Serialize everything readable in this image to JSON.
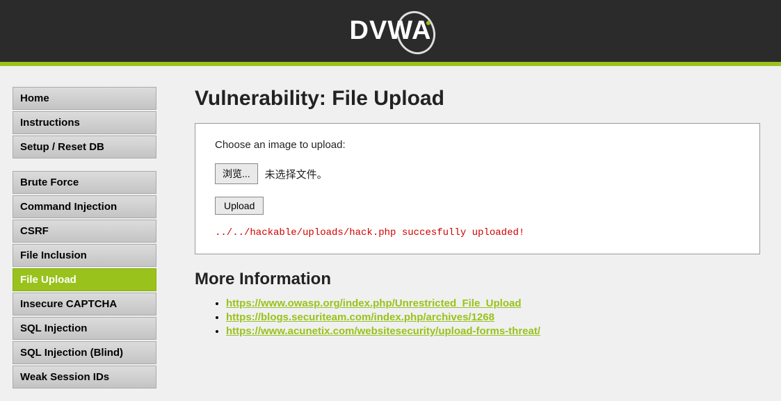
{
  "header": {
    "logo_text": "DVWA"
  },
  "sidebar": {
    "group1": [
      {
        "label": "Home",
        "name": "sidebar-item-home",
        "active": false
      },
      {
        "label": "Instructions",
        "name": "sidebar-item-instructions",
        "active": false
      },
      {
        "label": "Setup / Reset DB",
        "name": "sidebar-item-setup",
        "active": false
      }
    ],
    "group2": [
      {
        "label": "Brute Force",
        "name": "sidebar-item-brute-force",
        "active": false
      },
      {
        "label": "Command Injection",
        "name": "sidebar-item-command-injection",
        "active": false
      },
      {
        "label": "CSRF",
        "name": "sidebar-item-csrf",
        "active": false
      },
      {
        "label": "File Inclusion",
        "name": "sidebar-item-file-inclusion",
        "active": false
      },
      {
        "label": "File Upload",
        "name": "sidebar-item-file-upload",
        "active": true
      },
      {
        "label": "Insecure CAPTCHA",
        "name": "sidebar-item-insecure-captcha",
        "active": false
      },
      {
        "label": "SQL Injection",
        "name": "sidebar-item-sql-injection",
        "active": false
      },
      {
        "label": "SQL Injection (Blind)",
        "name": "sidebar-item-sql-injection-blind",
        "active": false
      },
      {
        "label": "Weak Session IDs",
        "name": "sidebar-item-weak-session-ids",
        "active": false
      }
    ]
  },
  "main": {
    "title": "Vulnerability: File Upload",
    "upload_label": "Choose an image to upload:",
    "browse_label": "浏览...",
    "file_status": "未选择文件。",
    "upload_button": "Upload",
    "result_message": "../../hackable/uploads/hack.php succesfully uploaded!",
    "more_info_title": "More Information",
    "links": [
      "https://www.owasp.org/index.php/Unrestricted_File_Upload",
      "https://blogs.securiteam.com/index.php/archives/1268",
      "https://www.acunetix.com/websitesecurity/upload-forms-threat/"
    ]
  }
}
